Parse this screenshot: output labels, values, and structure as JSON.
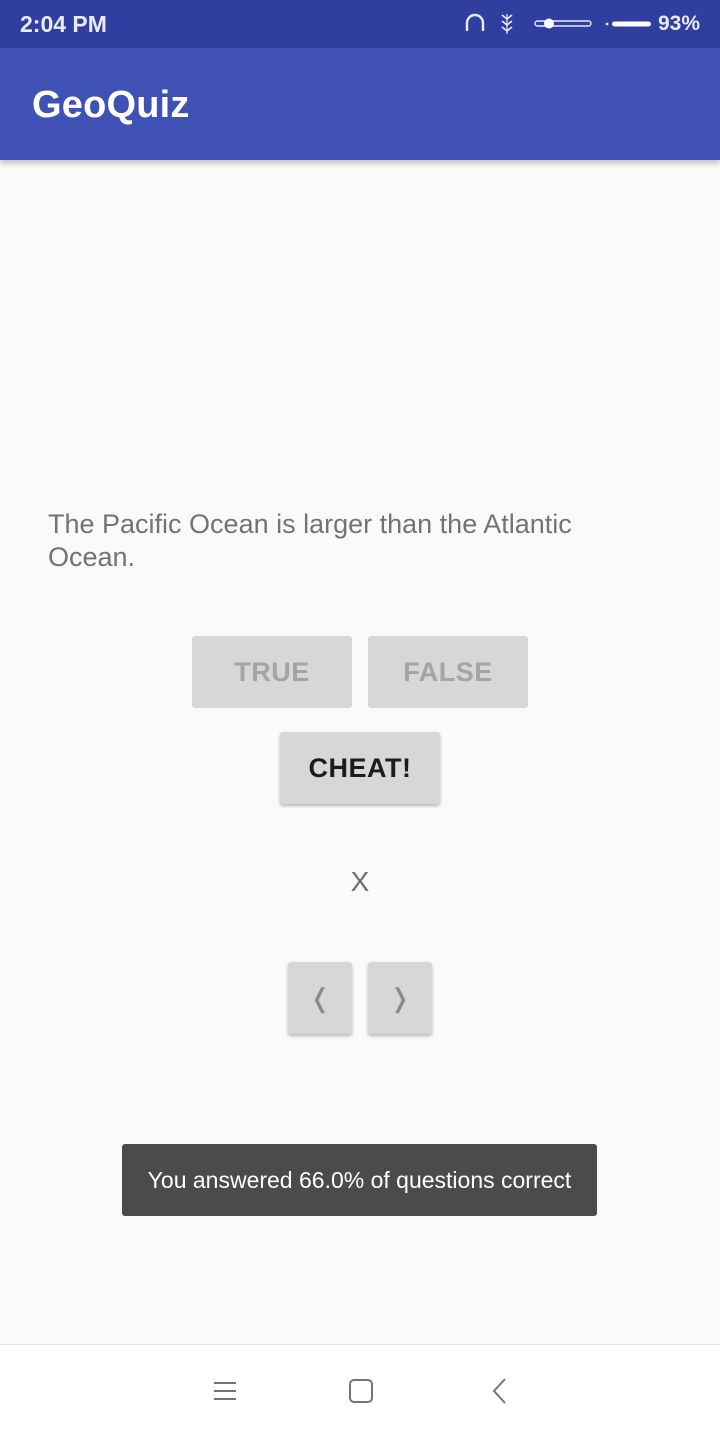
{
  "status_bar": {
    "time": "2:04 PM",
    "battery": "93%",
    "icons": [
      "headset-icon",
      "data-icon",
      "slider-icon",
      "battery-icon"
    ]
  },
  "app_bar": {
    "title": "GeoQuiz"
  },
  "quiz": {
    "question": "The Pacific Ocean is larger than the Atlantic Ocean.",
    "true_label": "TRUE",
    "false_label": "FALSE",
    "cheat_label": "CHEAT!",
    "answer_mark": "X",
    "prev_label": "❬",
    "next_label": "❭"
  },
  "toast": {
    "message": "You answered 66.0% of questions correct"
  },
  "navigation_bar": {
    "icons": [
      "menu-icon",
      "home-icon",
      "back-icon"
    ]
  },
  "colors": {
    "status_bar": "#303f9f",
    "app_bar": "#3f51b5",
    "background": "#fafafa",
    "button": "#d6d7d7",
    "toast": "#4b4b4b"
  }
}
